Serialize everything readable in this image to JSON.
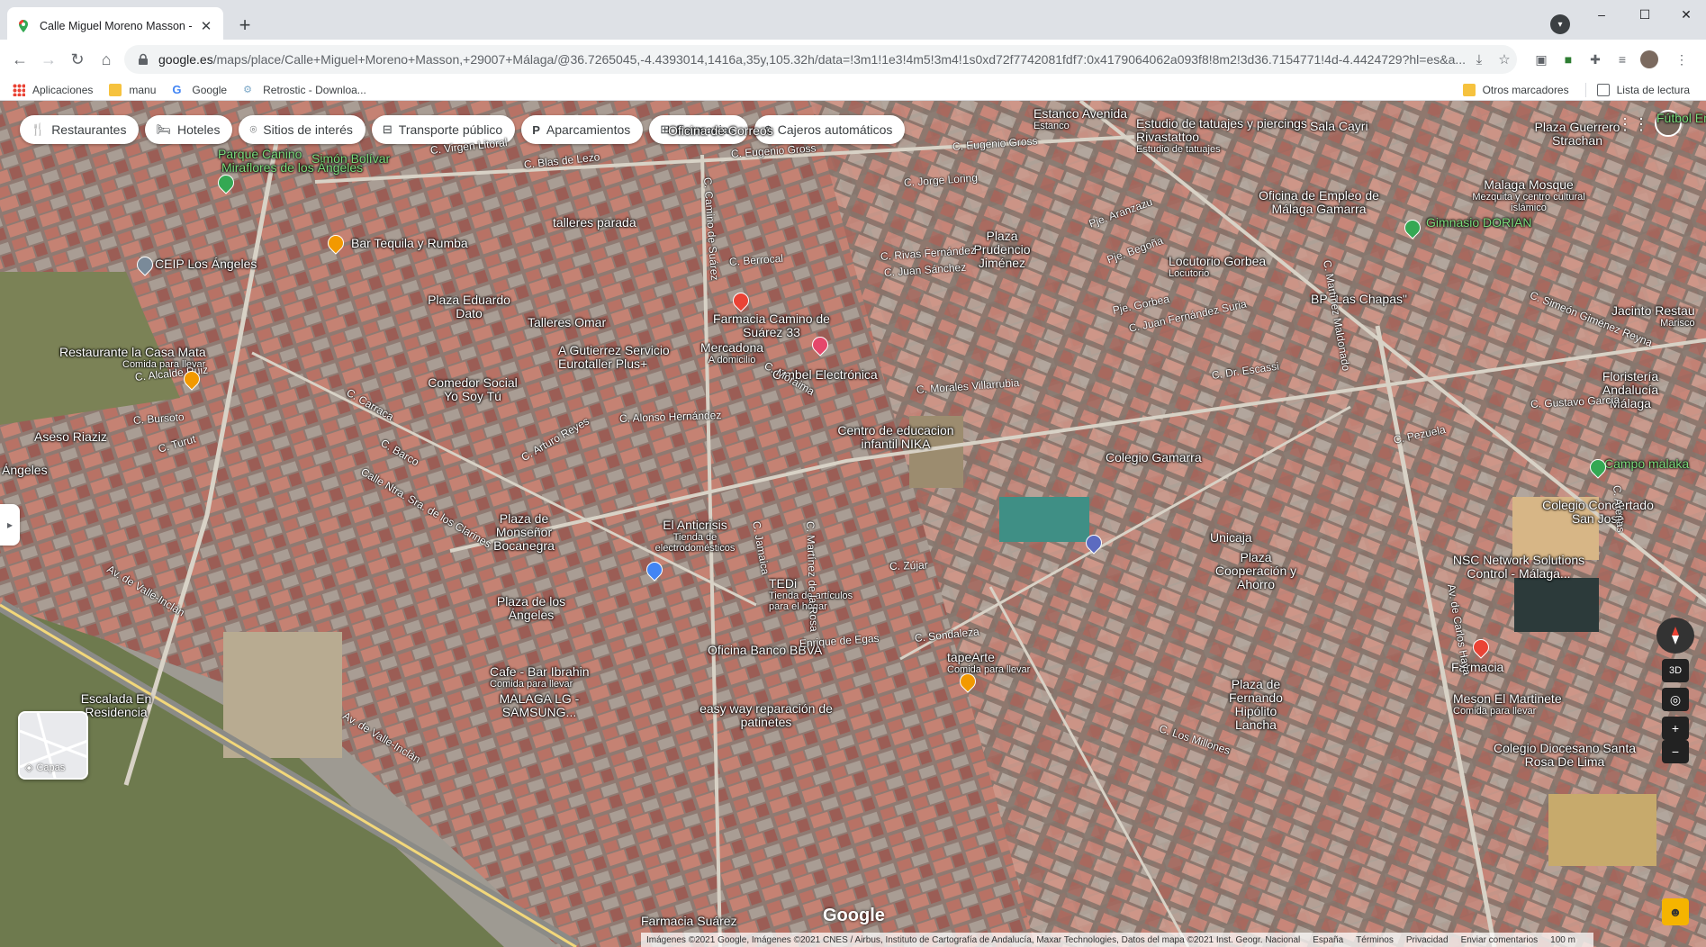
{
  "browser": {
    "tab_title": "Calle Miguel Moreno Masson - G",
    "tab_close": "✕",
    "new_tab": "+",
    "url_host": "google.es",
    "url_rest": "/maps/place/Calle+Miguel+Moreno+Masson,+29007+Málaga/@36.7265045,-4.4393014,1416a,35y,105.32h/data=!3m1!1e3!4m5!3m4!1s0xd72f7742081fdf7:0x4179064062a093f8!8m2!3d36.7154771!4d-4.4424729?hl=es&a...",
    "window_controls": [
      "–",
      "☐",
      "✕"
    ],
    "bookmarks": [
      {
        "label": "Aplicaciones",
        "icon": "apps-grid-icon"
      },
      {
        "label": "manu",
        "icon": "folder-icon"
      },
      {
        "label": "Google",
        "icon": "google-icon"
      },
      {
        "label": "Retrostic - Downloa...",
        "icon": "retrostic-icon"
      }
    ],
    "other_bookmarks": "Otros marcadores",
    "reading_list": "Lista de lectura"
  },
  "maps": {
    "categories": [
      {
        "label": "Restaurantes",
        "icon": "fork-knife-icon"
      },
      {
        "label": "Hoteles",
        "icon": "bed-icon"
      },
      {
        "label": "Sitios de interés",
        "icon": "camera-icon"
      },
      {
        "label": "Transporte público",
        "icon": "bus-icon"
      },
      {
        "label": "Aparcamientos",
        "icon": "parking-icon"
      },
      {
        "label": "Farmacias",
        "icon": "pharmacy-icon"
      },
      {
        "label": "Cajeros automáticos",
        "icon": "atm-icon"
      }
    ],
    "places": [
      {
        "name": "Parque Canino",
        "sub": "",
        "green": true
      },
      {
        "name": "Simón Bolívar",
        "sub": "",
        "green": true
      },
      {
        "name": "Miraflores de los Ángeles",
        "sub": "",
        "green": true
      },
      {
        "name": "Oficina de Correos",
        "sub": ""
      },
      {
        "name": "Estanco Avenida",
        "sub": "Estanco"
      },
      {
        "name": "Estudio de tatuajes y piercings Rivastattoo",
        "sub": "Estudio de tatuajes"
      },
      {
        "name": "Sala Cayri",
        "sub": ""
      },
      {
        "name": "Plaza Guerrero Strachan",
        "sub": ""
      },
      {
        "name": "Fútbol Emo",
        "sub": "",
        "green": true
      },
      {
        "name": "talleres parada",
        "sub": ""
      },
      {
        "name": "Bar Tequila y Rumba",
        "sub": ""
      },
      {
        "name": "CEIP Los Ángeles",
        "sub": ""
      },
      {
        "name": "Plaza Prudencio Jiménez",
        "sub": ""
      },
      {
        "name": "Oficina de Empleo de Málaga Gamarra",
        "sub": ""
      },
      {
        "name": "Malaga Mosque",
        "sub": "Mezquita y centro cultural islámico"
      },
      {
        "name": "Gimnasio DORIAN",
        "sub": "",
        "green": true
      },
      {
        "name": "Locutorio Gorbea",
        "sub": "Locutorio"
      },
      {
        "name": "Plaza Eduardo Dato",
        "sub": ""
      },
      {
        "name": "Talleres Omar",
        "sub": ""
      },
      {
        "name": "Farmacia Camino de Suárez 33",
        "sub": ""
      },
      {
        "name": "BP \"Las Chapas\"",
        "sub": ""
      },
      {
        "name": "Jacinto Restau",
        "sub": "Marisco"
      },
      {
        "name": "Restaurante la Casa Mata",
        "sub": "Comida para llevar"
      },
      {
        "name": "A Gutierrez Servicio Eurotaller Plus+",
        "sub": ""
      },
      {
        "name": "Mercadona",
        "sub": "A domicilio"
      },
      {
        "name": "Cimbel Electrónica",
        "sub": ""
      },
      {
        "name": "Floristería Andalucía Málaga",
        "sub": ""
      },
      {
        "name": "Comedor Social Yo Soy Tú",
        "sub": ""
      },
      {
        "name": "Aseso Riaziz",
        "sub": ""
      },
      {
        "name": "Centro de educacion infantil NIKA",
        "sub": ""
      },
      {
        "name": "Colegio Gamarra",
        "sub": ""
      },
      {
        "name": "Campo malaka",
        "sub": "",
        "green": true
      },
      {
        "name": "Ángeles",
        "sub": ""
      },
      {
        "name": "Colegio Concertado San José",
        "sub": ""
      },
      {
        "name": "El Anticrisis",
        "sub": "Tienda de electrodomésticos"
      },
      {
        "name": "Plaza de Monseñor Bocanegra",
        "sub": ""
      },
      {
        "name": "Unicaja",
        "sub": ""
      },
      {
        "name": "NSC Network Solutions Control - Málaga...",
        "sub": ""
      },
      {
        "name": "Plaza Cooperación y Ahorro",
        "sub": ""
      },
      {
        "name": "Plaza de los Ángeles",
        "sub": ""
      },
      {
        "name": "TEDi",
        "sub": "Tienda de artículos para el hogar"
      },
      {
        "name": "Oficina Banco BBVA",
        "sub": ""
      },
      {
        "name": "tapeArte",
        "sub": "Comida para llevar"
      },
      {
        "name": "Farmacia",
        "sub": ""
      },
      {
        "name": "Cafe - Bar Ibrahin",
        "sub": "Comida para llevar"
      },
      {
        "name": "Plaza de Fernando Hipólito Lancha",
        "sub": ""
      },
      {
        "name": "Meson El Martinete",
        "sub": "Comida para llevar"
      },
      {
        "name": "Escalada En Residencia",
        "sub": ""
      },
      {
        "name": "MALAGA LG - SAMSUNG...",
        "sub": ""
      },
      {
        "name": "easy way reparación de patinetes",
        "sub": ""
      },
      {
        "name": "Colegio Diocesano Santa Rosa De Lima",
        "sub": ""
      },
      {
        "name": "Farmacia Suárez",
        "sub": ""
      }
    ],
    "streets": [
      "Av. de Valle-Inclán",
      "Av. de Valle-Inclán",
      "C. Eugenio Gross",
      "C. Eugenio Gross",
      "C. Blas de Lezo",
      "C. Virgen Litoral",
      "C. Jorge Loring",
      "C. Rivas Fernández",
      "C. Berrocal",
      "C. Juan Sánchez",
      "C. Alonso Hernández",
      "C. Morales Villarrubia",
      "C. Dr. Escassi",
      "C. Gustavo García",
      "C. Alcalde Ruiz",
      "C. Bursoto",
      "C. Turut",
      "C. Sondaleza",
      "Enrique de Egas",
      "C. Zújar",
      "C. Los Millones",
      "Pje. Gorbea",
      "C. Juan Fernández Suria",
      "Pje. Begoña",
      "Pje. Aranzazu",
      "C. Simeón Giménez Reyna",
      "C. Carraca",
      "C. Barco",
      "Calle Ntra. Sra. de los Clarines",
      "C. Arturo Reyes",
      "C. Jamaica",
      "C. Martínez de la Rosa",
      "C. Martínez Maldonado",
      "Av. de Carlos Haya",
      "C. Pezuela",
      "C. Arenas",
      "C. Camino de Suárez",
      "C. Moraima"
    ],
    "layers_label": "Capas",
    "google_logo": "Google",
    "footer": [
      "Imágenes ©2021 Google, Imágenes ©2021 CNES / Airbus, Instituto de Cartografía de Andalucía, Maxar Technologies, Datos del mapa ©2021 Inst. Geogr. Nacional",
      "España",
      "Términos",
      "Privacidad",
      "Enviar comentarios",
      "100 m"
    ],
    "controls": {
      "three_d": "3D",
      "zoom_in": "+",
      "zoom_out": "−"
    }
  }
}
